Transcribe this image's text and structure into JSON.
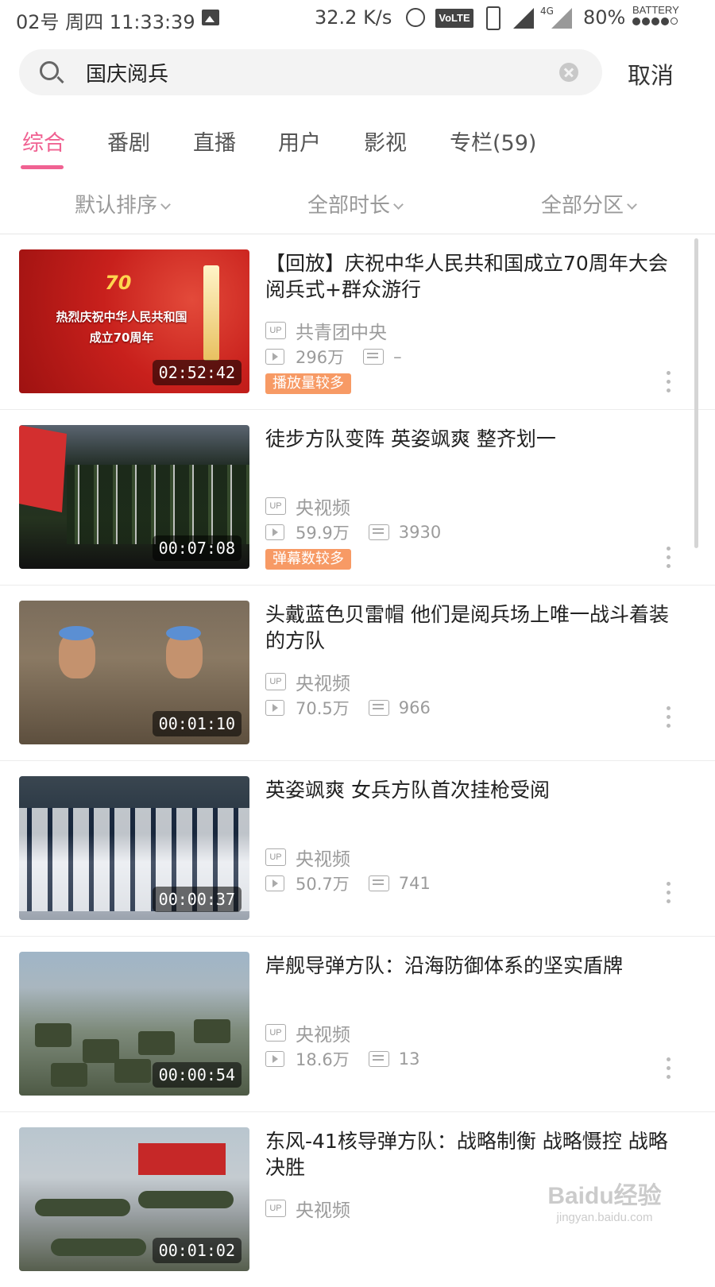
{
  "status_bar": {
    "left_text": "02号 周四 11:33:39",
    "speed": "32.2 K/s",
    "volte": "VoLTE",
    "data_label": "4G",
    "battery_pct": "80%",
    "battery_label": "BATTERY"
  },
  "search": {
    "query": "国庆阅兵",
    "cancel_label": "取消"
  },
  "tabs": [
    "综合",
    "番剧",
    "直播",
    "用户",
    "影视",
    "专栏(59)"
  ],
  "active_tab": "综合",
  "filters": [
    "默认排序",
    "全部时长",
    "全部分区"
  ],
  "videos": [
    {
      "title": "【回放】庆祝中华人民共和国成立70周年大会 阅兵式+群众游行",
      "duration": "02:52:42",
      "uploader": "共青团中央",
      "views": "296万",
      "danmaku": "–",
      "tag": "播放量较多",
      "thumb_text_line1": "热烈庆祝中华人民共和国",
      "thumb_text_line2": "成立70周年",
      "thumb_logo": "70"
    },
    {
      "title": "徒步方队变阵 英姿飒爽 整齐划一",
      "duration": "00:07:08",
      "uploader": "央视频",
      "views": "59.9万",
      "danmaku": "3930",
      "tag": "弹幕数较多"
    },
    {
      "title": "头戴蓝色贝雷帽 他们是阅兵场上唯一战斗着装的方队",
      "duration": "00:01:10",
      "uploader": "央视频",
      "views": "70.5万",
      "danmaku": "966"
    },
    {
      "title": "英姿飒爽 女兵方队首次挂枪受阅",
      "duration": "00:00:37",
      "uploader": "央视频",
      "views": "50.7万",
      "danmaku": "741"
    },
    {
      "title": "岸舰导弹方队：沿海防御体系的坚实盾牌",
      "duration": "00:00:54",
      "uploader": "央视频",
      "views": "18.6万",
      "danmaku": "13"
    },
    {
      "title": "东风-41核导弹方队：战略制衡 战略慑控 战略决胜",
      "duration": "00:01:02",
      "uploader": "央视频"
    }
  ],
  "up_badge": "UP",
  "watermark": {
    "main": "Baidu经验",
    "sub": "jingyan.baidu.com"
  },
  "colors": {
    "accent": "#f06292",
    "tag_bg": "#f79a65"
  }
}
